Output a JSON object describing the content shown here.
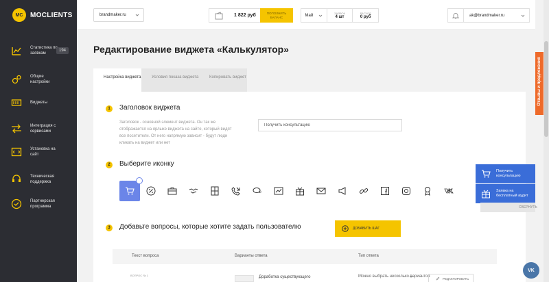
{
  "brand": {
    "logo_mark": "MC",
    "name": "MOCLIENTS",
    "accent_color": "#f5c400",
    "sidebar_color": "#2c2d33"
  },
  "sidebar": {
    "items": [
      {
        "label": "Статистика по заявкам",
        "badge": "194",
        "icon": "chart-icon"
      },
      {
        "label": "Общие настройки",
        "icon": "gears-icon"
      },
      {
        "label": "Виджеты",
        "icon": "widgets-icon"
      },
      {
        "label": "Интеграция с сервисами",
        "icon": "integration-icon"
      },
      {
        "label": "Установка на сайт",
        "icon": "install-icon"
      },
      {
        "label": "Техническая поддержка",
        "icon": "support-icon"
      },
      {
        "label": "Партнерская программа",
        "icon": "partner-icon"
      }
    ]
  },
  "header": {
    "site_select": "brandmaker.ru",
    "balance": "1 822 руб",
    "topup_label": "ПОПОЛНИТЬ БАЛАНС",
    "stats": {
      "month": "Май",
      "leads_caption": "ЗАЯВОК",
      "leads_value": "4 шт",
      "spent_caption": "РАСХОД",
      "spent_value": "0 руб"
    },
    "email": "ak@brandmaker.ru"
  },
  "page": {
    "title": "Редактирование виджета «Калькулятор»"
  },
  "tabs": [
    {
      "label": "Настройка виджета",
      "active": true
    },
    {
      "label": "Условия показа виджета",
      "active": false
    },
    {
      "label": "Копировать виджет",
      "active": false
    }
  ],
  "step1": {
    "num": "1",
    "title": "Заголовок виджета",
    "description": "Заголовок - основной элемент виджета. Он так же отображается на ярлыке виджета на сайте, который видят все посетители. От него напрямую зависит - будут люди кликать на виджет или нет",
    "input_value": "Получить консультацию"
  },
  "step2": {
    "num": "2",
    "title": "Выберите иконку",
    "icons": [
      "cart-icon",
      "percent-icon",
      "briefcase-icon",
      "handshake-icon",
      "calculator-icon",
      "phone-call-icon",
      "chat-icon",
      "chart-line-icon",
      "gift-icon",
      "envelope-icon",
      "megaphone-icon",
      "link-icon",
      "facebook-icon",
      "instagram-icon",
      "award-icon",
      "vk-icon"
    ],
    "selected_index": 0
  },
  "step3": {
    "num": "3",
    "title": "Добавьте вопросы, которые хотите задать пользователю",
    "add_label": "ДОБАВИТЬ ШАГ",
    "columns": [
      "Текст вопроса",
      "Варианты ответа",
      "Тип ответа"
    ],
    "rows": [
      {
        "tag": "ВОПРОС № 1",
        "answer": "Доработка существующего",
        "type": "Можно выбрать несколько вариантов",
        "edit_label": "РЕДАКТИРОВАТЬ"
      }
    ]
  },
  "feedback": {
    "label": "Отзывы и предложения",
    "color": "#ee6a2a"
  },
  "preview": {
    "cards": [
      {
        "label": "Получить консультацию",
        "icon": "cart-icon"
      },
      {
        "label": "Заявка на бесплатный аудит",
        "icon": "gift-icon"
      }
    ],
    "collapse_label": "СВЕРНУТЬ",
    "color": "#3a6dd8"
  },
  "vk_button": "VK"
}
